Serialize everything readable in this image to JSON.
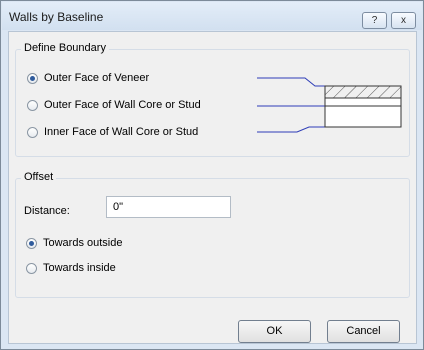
{
  "window": {
    "title": "Walls by Baseline",
    "help_label": "?",
    "close_label": "x"
  },
  "boundary": {
    "title": "Define Boundary",
    "options": [
      {
        "label": "Outer Face of Veneer",
        "selected": true
      },
      {
        "label": "Outer Face of Wall Core or Stud",
        "selected": false
      },
      {
        "label": "Inner Face of Wall Core or Stud",
        "selected": false
      }
    ],
    "diagram": {
      "line_color": "#2e3db7"
    }
  },
  "offset": {
    "title": "Offset",
    "distance_label": "Distance:",
    "distance_value": "0\"",
    "options": [
      {
        "label": "Towards outside",
        "selected": true
      },
      {
        "label": "Towards inside",
        "selected": false
      }
    ]
  },
  "buttons": {
    "ok_label": "OK",
    "cancel_label": "Cancel"
  }
}
